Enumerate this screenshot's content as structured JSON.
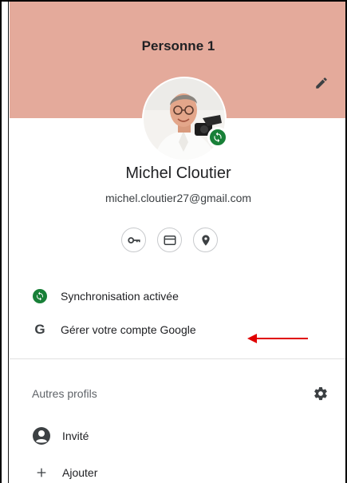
{
  "profile": {
    "header_title": "Personne 1",
    "name": "Michel Cloutier",
    "email": "michel.cloutier27@gmail.com"
  },
  "quick_actions": [
    {
      "icon": "key-icon"
    },
    {
      "icon": "credit-card-icon"
    },
    {
      "icon": "location-pin-icon"
    }
  ],
  "menu": {
    "sync_label": "Synchronisation activée",
    "manage_account_label": "Gérer votre compte Google",
    "google_letter": "G"
  },
  "other_profiles": {
    "heading": "Autres profils",
    "guest_label": "Invité",
    "add_label": "Ajouter"
  },
  "colors": {
    "header_bg": "#e4aa9b",
    "sync_green": "#188038",
    "annotation_arrow": "#e00000"
  }
}
